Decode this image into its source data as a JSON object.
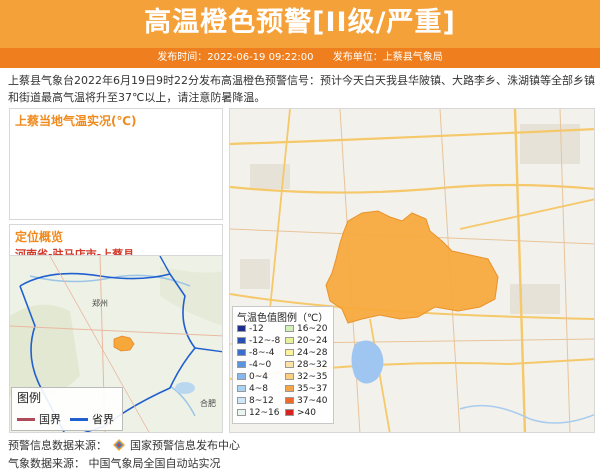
{
  "header": {
    "title": "高温橙色预警[II级/严重]",
    "publish_time": "发布时间：2022-06-19 09:22:00",
    "publisher": "发布单位：上蔡县气象局"
  },
  "description": "上蔡县气象台2022年6月19日9时22分发布高温橙色预警信号：预计今天白天我县华陂镇、大路李乡、洙湖镇等全部乡镇和街道最高气温将升至37℃以上，请注意防暑降温。",
  "left_panel": {
    "temp_title": "上蔡当地气温实况(℃)",
    "location_title": "定位概览",
    "location_path": "河南省-驻马店市-上蔡县"
  },
  "mini_map": {
    "legend_title": "图例",
    "legend_items": [
      {
        "label": "国界",
        "color": "#b04a5a"
      },
      {
        "label": "省界",
        "color": "#1f5fcf"
      }
    ],
    "place_labels": [
      "郑州",
      "合肥"
    ]
  },
  "map_legend": {
    "title": "气温色值图例（℃）",
    "items": [
      {
        "label": "-12",
        "color": "#1c2f8f"
      },
      {
        "label": "-12~-8",
        "color": "#2a4fb3"
      },
      {
        "label": "-8~-4",
        "color": "#3a6fd0"
      },
      {
        "label": "-4~0",
        "color": "#5a93e0"
      },
      {
        "label": "0~4",
        "color": "#86b8ee"
      },
      {
        "label": "4~8",
        "color": "#a9d3f4"
      },
      {
        "label": "8~12",
        "color": "#cfe8f7"
      },
      {
        "label": "12~16",
        "color": "#e9f6ef"
      },
      {
        "label": "16~20",
        "color": "#d3efb8"
      },
      {
        "label": "20~24",
        "color": "#e8f29a"
      },
      {
        "label": "24~28",
        "color": "#fbf2a0"
      },
      {
        "label": "28~32",
        "color": "#fde3a8"
      },
      {
        "label": "32~35",
        "color": "#fbcf7f"
      },
      {
        "label": "35~37",
        "color": "#f7a348"
      },
      {
        "label": "37~40",
        "color": "#ef6a2a"
      },
      {
        "label": ">40",
        "color": "#d8221f"
      }
    ]
  },
  "footer": {
    "warning_source_label": "预警信息数据来源：",
    "warning_source": "国家预警信息发布中心",
    "weather_source_label": "气象数据来源：",
    "weather_source": "中国气象局全国自动站实况"
  },
  "colors": {
    "header_bg": "#f5a13a",
    "header_meta_bg": "#ef7f1e",
    "region_fill": "#f7a83a",
    "accent_title": "#f08a1c",
    "path_text": "#d23a2a"
  }
}
